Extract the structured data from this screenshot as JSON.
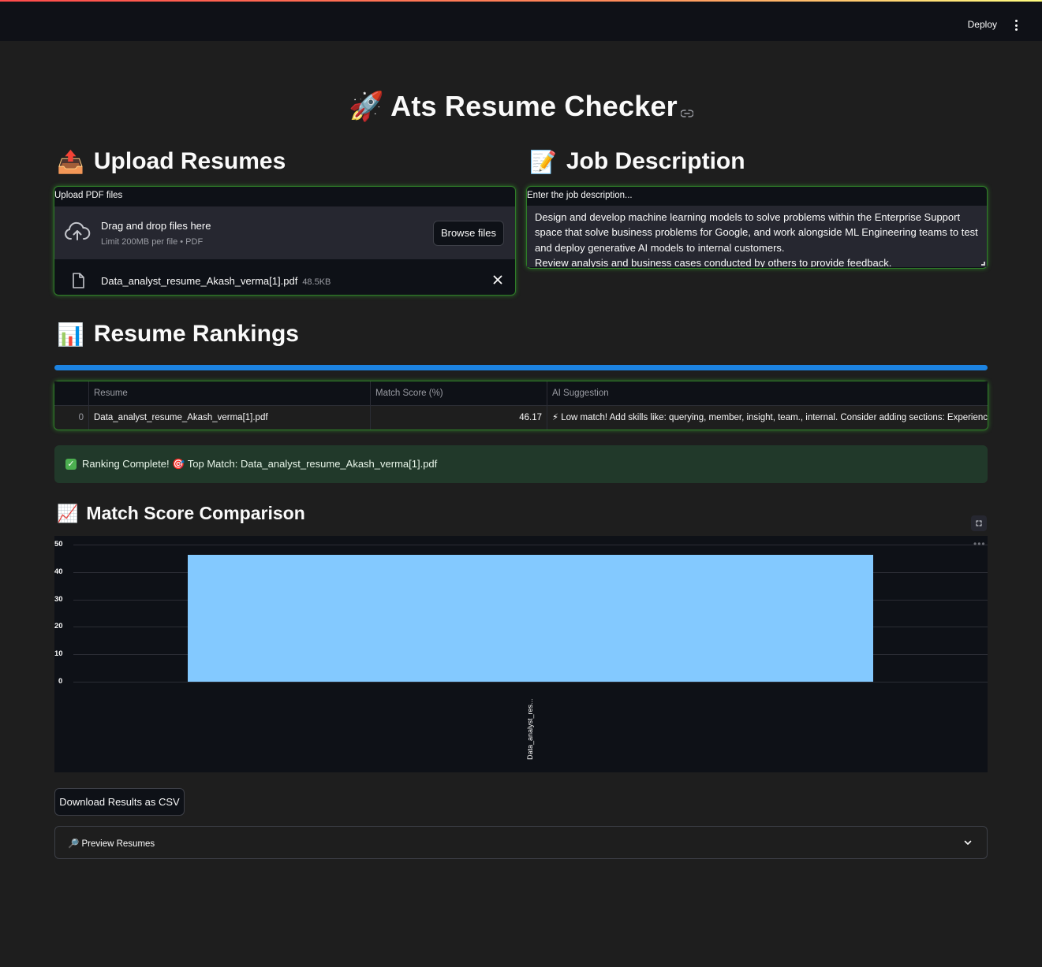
{
  "header": {
    "deploy_label": "Deploy",
    "menu_icon": "kebab-menu-icon"
  },
  "app": {
    "title_emoji": "🚀",
    "title": "Ats Resume Checker"
  },
  "upload": {
    "heading_emoji": "📤",
    "heading": "Upload Resumes",
    "field_label": "Upload PDF files",
    "drop_title": "Drag and drop files here",
    "drop_subtitle": "Limit 200MB per file • PDF",
    "browse_label": "Browse files",
    "file": {
      "name": "Data_analyst_resume_Akash_verma[1].pdf",
      "size": "48.5KB"
    }
  },
  "job": {
    "heading_emoji": "📝",
    "heading": "Job Description",
    "field_label": "Enter the job description...",
    "lines": [
      "Design and develop machine learning models to solve problems within the Enterprise Support",
      "space that solve business problems for Google, and work alongside ML Engineering teams to test",
      "and deploy generative AI models to internal customers.",
      "Review analysis and business cases conducted by others to provide feedback."
    ]
  },
  "rankings": {
    "heading_emoji": "📊",
    "heading": "Resume Rankings",
    "progress": 1.0,
    "columns": [
      "",
      "Resume",
      "Match Score (%)",
      "AI Suggestion"
    ],
    "rows": [
      {
        "index": "0",
        "resume": "Data_analyst_resume_Akash_verma[1].pdf",
        "score": "46.17",
        "suggestion": "⚡ Low match! Add skills like: querying, member, insight, team., internal. Consider adding sections: Experience"
      }
    ]
  },
  "success": {
    "text_before": "Ranking Complete!",
    "target_emoji": "🎯",
    "text_after": "Top Match: Data_analyst_resume_Akash_verma[1].pdf"
  },
  "comparison": {
    "heading_emoji": "📈",
    "heading": "Match Score Comparison"
  },
  "chart_data": {
    "type": "bar",
    "categories": [
      "Data_analyst_res..."
    ],
    "values": [
      46.17
    ],
    "ylim": [
      0,
      50
    ],
    "yticks": [
      0,
      10,
      20,
      30,
      40,
      50
    ],
    "color": "#83c9ff",
    "grid": true
  },
  "actions": {
    "download_label": "Download Results as CSV",
    "preview_label": "🔎 Preview Resumes"
  },
  "colors": {
    "accent": "#1c83e1",
    "success_bg": "#21392a",
    "bar": "#83c9ff",
    "focus_border": "#2f7d28"
  }
}
